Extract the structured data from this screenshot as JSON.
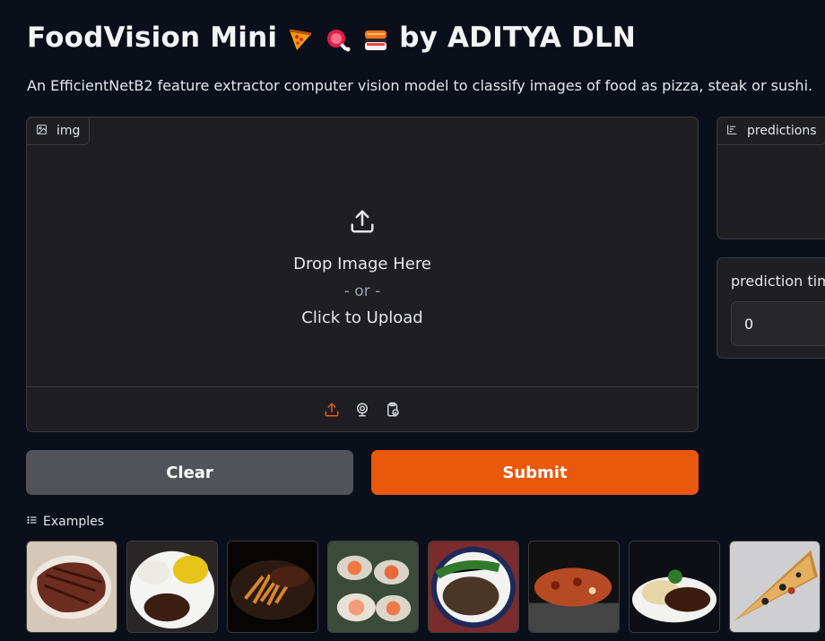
{
  "header": {
    "title_prefix": "FoodVision Mini",
    "title_suffix": "by ADITYA DLN",
    "emojis": [
      "pizza-emoji",
      "meat-emoji",
      "sushi-emoji"
    ],
    "description": "An EfficientNetB2 feature extractor computer vision model to classify images of food as pizza, steak or sushi."
  },
  "image_input": {
    "label": "img",
    "drop_text": "Drop Image Here",
    "or_text": "- or -",
    "click_text": "Click to Upload",
    "sources": [
      "upload-icon",
      "webcam-icon",
      "clipboard-icon"
    ],
    "active_color": "#ea580c"
  },
  "buttons": {
    "clear_label": "Clear",
    "submit_label": "Submit",
    "submit_color": "#ea580c",
    "clear_color": "#52525b"
  },
  "predictions": {
    "label": "predictions"
  },
  "prediction_time": {
    "label": "prediction time (s)",
    "value": "0"
  },
  "examples": {
    "label": "Examples",
    "items": [
      "steak",
      "steak",
      "steak",
      "sushi",
      "steak",
      "pizza",
      "steak",
      "pizza"
    ]
  }
}
